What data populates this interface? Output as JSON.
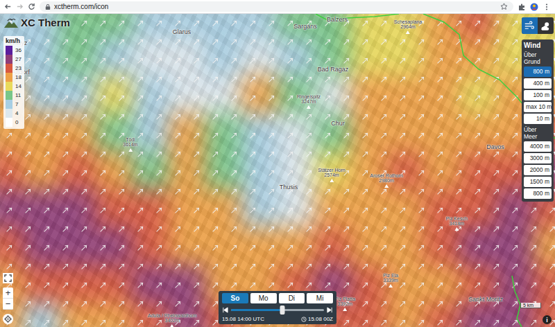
{
  "browser": {
    "url": "xctherm.com/icon"
  },
  "logo": {
    "text": "XC Therm"
  },
  "legend": {
    "unit": "km/h",
    "steps": [
      {
        "label": "36",
        "color": "#5b1e9e"
      },
      {
        "label": "27",
        "color": "#8f3d78"
      },
      {
        "label": "23",
        "color": "#d9593f"
      },
      {
        "label": "18",
        "color": "#eea046"
      },
      {
        "label": "14",
        "color": "#e9da5c"
      },
      {
        "label": "11",
        "color": "#78c689"
      },
      {
        "label": "7",
        "color": "#a7cfe4"
      },
      {
        "label": "4",
        "color": "#dde8ee"
      },
      {
        "label": "0",
        "color": "#ffffff"
      }
    ]
  },
  "wind_field": {
    "unit": "km/h",
    "toward_deg": 45,
    "rows": [
      [
        10,
        10,
        12,
        11,
        10,
        9,
        10,
        9,
        11,
        13,
        15,
        16,
        22,
        25,
        17,
        15
      ],
      [
        9,
        7,
        12,
        10,
        6,
        5,
        7,
        5,
        9,
        13,
        16,
        16,
        18,
        20,
        16,
        17
      ],
      [
        20,
        9,
        10,
        14,
        8,
        4,
        6,
        20,
        11,
        6,
        18,
        20,
        18,
        17,
        21,
        22
      ],
      [
        22,
        18,
        22,
        13,
        10,
        20,
        11,
        9,
        6,
        11,
        22,
        19,
        20,
        22,
        22,
        26
      ],
      [
        26,
        22,
        23,
        22,
        12,
        19,
        12,
        9,
        5,
        15,
        21,
        23,
        22,
        23,
        26,
        27
      ],
      [
        28,
        30,
        29,
        26,
        24,
        22,
        20,
        10,
        6,
        20,
        22,
        22,
        23,
        24,
        28,
        23
      ],
      [
        24,
        29,
        28,
        27,
        24,
        22,
        22,
        20,
        21,
        24,
        22,
        21,
        23,
        28,
        29,
        22
      ],
      [
        22,
        24,
        26,
        24,
        28,
        29,
        22,
        22,
        24,
        27,
        23,
        21,
        22,
        24,
        27,
        24
      ],
      [
        22,
        10,
        18,
        22,
        26,
        27,
        24,
        22,
        22,
        24,
        23,
        22,
        25,
        27,
        29,
        26
      ]
    ]
  },
  "places": [
    {
      "name": "Schwyz",
      "kind": "town"
    },
    {
      "name": "Altdorf",
      "kind": "town"
    },
    {
      "name": "Glarus",
      "kind": "town"
    },
    {
      "name": "Sargans",
      "kind": "town"
    },
    {
      "name": "Balzers",
      "kind": "town"
    },
    {
      "name": "Bad Ragaz",
      "kind": "town"
    },
    {
      "name": "Chur",
      "kind": "town"
    },
    {
      "name": "Thusis",
      "kind": "town"
    },
    {
      "name": "Davos",
      "kind": "town"
    },
    {
      "name": "Sankt Moritz",
      "kind": "town"
    },
    {
      "name": "Schesaplana",
      "elevation": "2964m",
      "kind": "peak"
    },
    {
      "name": "Ringelspitz",
      "elevation": "3247m",
      "kind": "peak"
    },
    {
      "name": "Tödi",
      "elevation": "3614m",
      "kind": "peak"
    },
    {
      "name": "Stätzer Horn",
      "elevation": "2574m",
      "kind": "peak"
    },
    {
      "name": "Aroser Rothorn",
      "elevation": "2980m",
      "kind": "peak"
    },
    {
      "name": "Piz Kesch",
      "elevation": "3418m",
      "kind": "peak"
    },
    {
      "name": "Piz Ela",
      "elevation": "3339m",
      "kind": "peak"
    },
    {
      "name": "Piz Platta",
      "elevation": "3392m",
      "kind": "peak"
    },
    {
      "name": "Adula / Rheinwaldhorn",
      "elevation": "3402m",
      "kind": "peak"
    }
  ],
  "layer_buttons": [
    {
      "kind": "wind",
      "selected": true
    },
    {
      "kind": "weather",
      "selected": false
    }
  ],
  "height_panel": {
    "title": "Wind",
    "groups": [
      {
        "title": "Über Grund",
        "options": [
          {
            "label": "800 m",
            "selected": true
          },
          {
            "label": "400 m",
            "selected": false
          },
          {
            "label": "100 m",
            "selected": false
          },
          {
            "label": "max 10 m",
            "selected": false
          },
          {
            "label": "10 m",
            "selected": false
          }
        ]
      },
      {
        "title": "Über Meer",
        "options": [
          {
            "label": "4000 m",
            "selected": false
          },
          {
            "label": "3000 m",
            "selected": false
          },
          {
            "label": "2000 m",
            "selected": false
          },
          {
            "label": "1500 m",
            "selected": false
          },
          {
            "label": "800 m",
            "selected": false
          }
        ]
      }
    ]
  },
  "timeline": {
    "days": [
      {
        "label": "So",
        "selected": true
      },
      {
        "label": "Mo",
        "selected": false
      },
      {
        "label": "Di",
        "selected": false
      },
      {
        "label": "Mi",
        "selected": false
      }
    ],
    "level": 0.55,
    "time": "15.08 14:00 UTC",
    "run": "15.08 00Z"
  },
  "map_controls": {
    "zoom_in": "+",
    "zoom_out": "−"
  },
  "scale": "5 km",
  "info": "i"
}
